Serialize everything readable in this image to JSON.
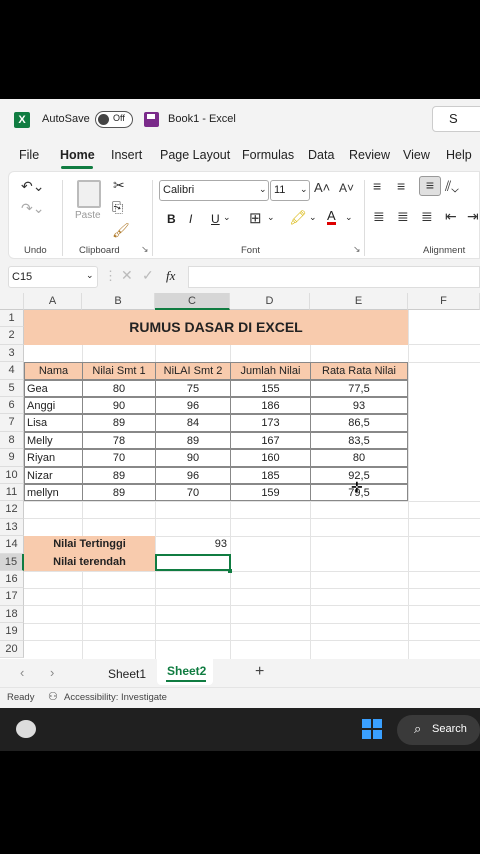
{
  "titlebar": {
    "autosave_label": "AutoSave",
    "autosave_state": "Off",
    "doc_title": "Book1  -  Excel",
    "search_glyph": "S"
  },
  "tabs": [
    "File",
    "Home",
    "Insert",
    "Page Layout",
    "Formulas",
    "Data",
    "Review",
    "View",
    "Help"
  ],
  "ribbon": {
    "undo_label": "Undo",
    "clipboard_label": "Clipboard",
    "paste_label": "Paste",
    "font_label": "Font",
    "alignment_label": "Alignment",
    "font_name": "Calibri",
    "font_size": "11",
    "bold": "B",
    "italic": "I",
    "underline": "U"
  },
  "formula_bar": {
    "name_box": "C15",
    "fx": "fx",
    "value": ""
  },
  "columns": [
    "A",
    "B",
    "C",
    "D",
    "E",
    "F"
  ],
  "rows": [
    "1",
    "2",
    "3",
    "4",
    "5",
    "6",
    "7",
    "8",
    "9",
    "10",
    "11",
    "12",
    "13",
    "14",
    "15",
    "16",
    "17",
    "18",
    "19",
    "20"
  ],
  "sheet": {
    "title": "RUMUS DASAR DI EXCEL",
    "headers": [
      "Nama",
      "Nilai Smt 1",
      "NiLAI Smt 2",
      "Jumlah Nilai",
      "Rata Rata Nilai"
    ],
    "data": [
      [
        "Gea",
        "80",
        "75",
        "155",
        "77,5"
      ],
      [
        "Anggi",
        "90",
        "96",
        "186",
        "93"
      ],
      [
        "Lisa",
        "89",
        "84",
        "173",
        "86,5"
      ],
      [
        "Melly",
        "78",
        "89",
        "167",
        "83,5"
      ],
      [
        "Riyan",
        "70",
        "90",
        "160",
        "80"
      ],
      [
        "Nizar",
        "89",
        "96",
        "185",
        "92,5"
      ],
      [
        "mellyn",
        "89",
        "70",
        "159",
        "79,5"
      ]
    ],
    "max_label": "Nilai Tertinggi",
    "max_value": "93",
    "min_label": "Nilai terendah"
  },
  "sheet_tabs": [
    "Sheet1",
    "Sheet2"
  ],
  "active_sheet": "Sheet2",
  "status": {
    "ready": "Ready",
    "accessibility": "Accessibility: Investigate"
  },
  "taskbar": {
    "search": "Search"
  },
  "colors": {
    "accent": "#107c41",
    "peach": "#f8cbad"
  }
}
